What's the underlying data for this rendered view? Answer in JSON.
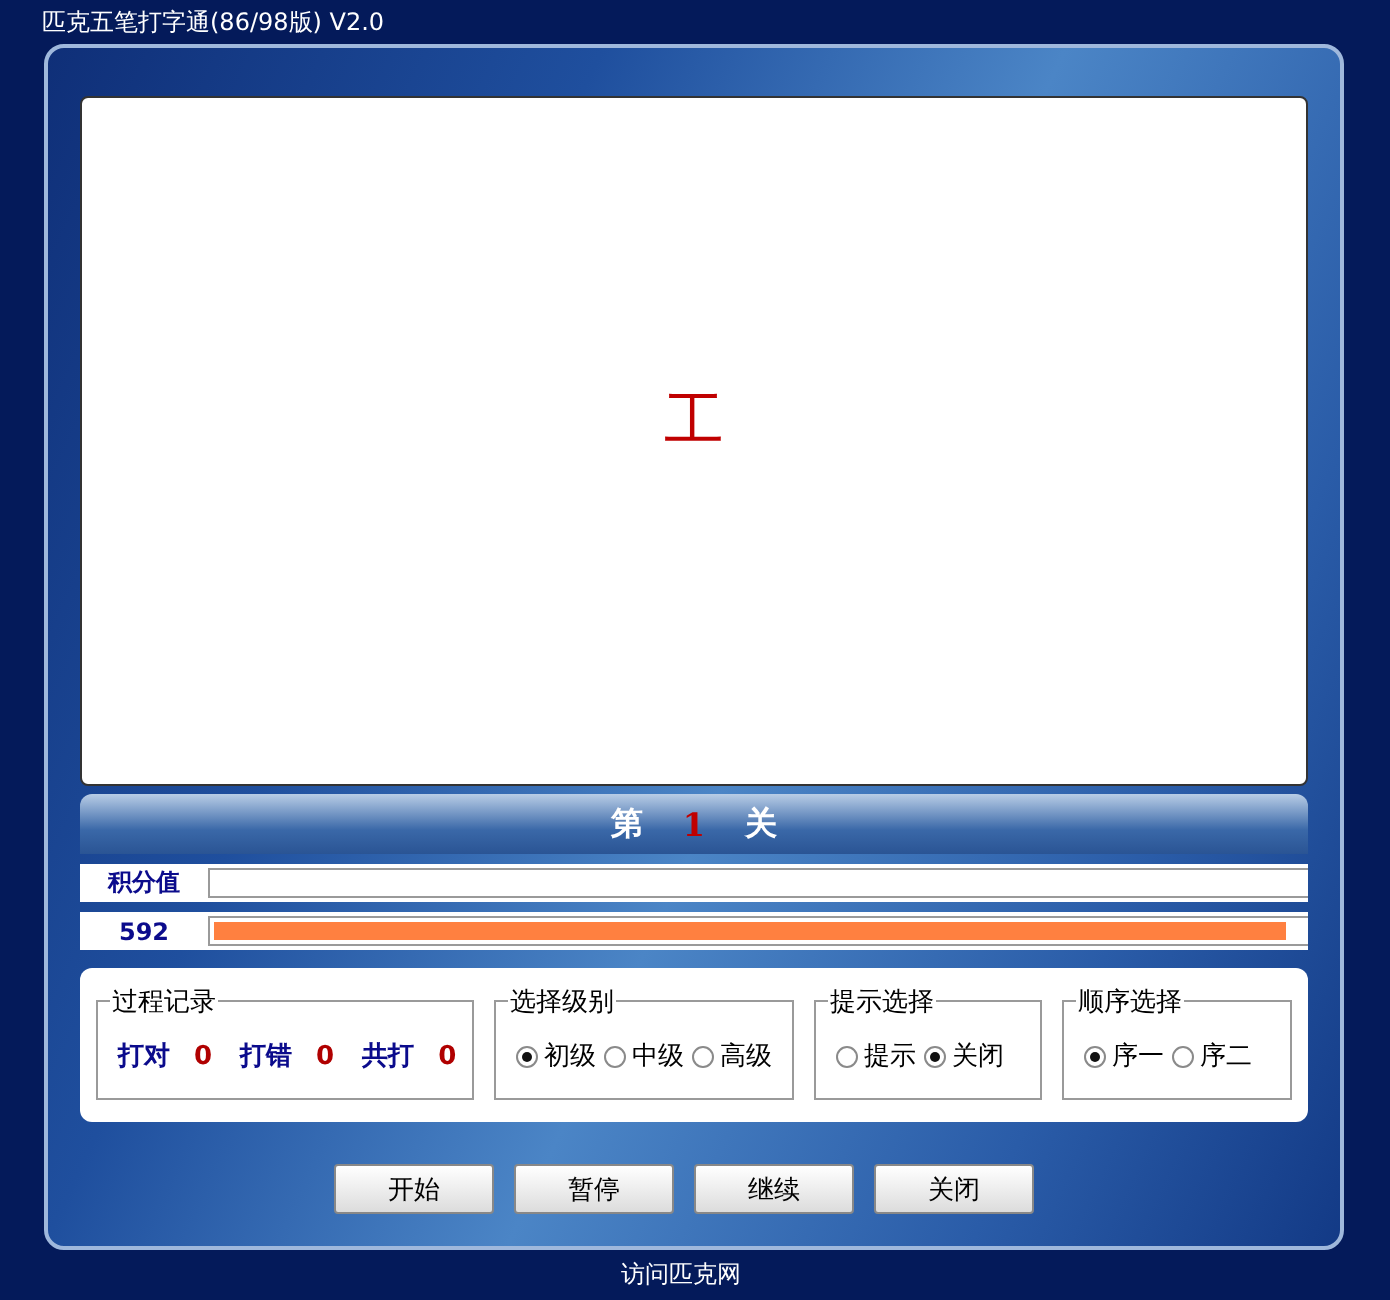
{
  "window": {
    "title": "匹克五笔打字通(86/98版) V2.0"
  },
  "display": {
    "character": "工"
  },
  "level_banner": {
    "prefix": "第",
    "number": "1",
    "suffix": "关"
  },
  "score_row": {
    "label": "积分值"
  },
  "time_row": {
    "value": "592",
    "level": 0.99
  },
  "groups": [
    {
      "kind": "stats",
      "title": "过程记录",
      "items": [
        {
          "label": "打对",
          "value": "0"
        },
        {
          "label": "打错",
          "value": "0"
        },
        {
          "label": "共打",
          "value": "0"
        }
      ]
    },
    {
      "kind": "radios",
      "title": "选择级别",
      "options": [
        {
          "label": "初级",
          "selected": true
        },
        {
          "label": "中级",
          "selected": false
        },
        {
          "label": "高级",
          "selected": false
        }
      ]
    },
    {
      "kind": "radios",
      "title": "提示选择",
      "options": [
        {
          "label": "提示",
          "selected": false
        },
        {
          "label": "关闭",
          "selected": true
        }
      ]
    },
    {
      "kind": "radios",
      "title": "顺序选择",
      "options": [
        {
          "label": "序一",
          "selected": true
        },
        {
          "label": "序二",
          "selected": false
        }
      ]
    }
  ],
  "buttons": [
    "开始",
    "暂停",
    "继续",
    "关闭"
  ],
  "link": "访问匹克网"
}
